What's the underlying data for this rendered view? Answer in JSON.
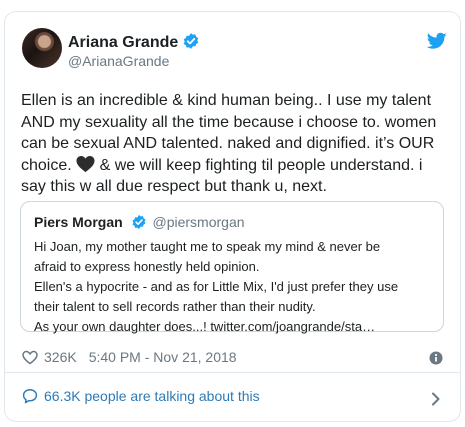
{
  "tweet": {
    "author": {
      "name": "Ariana Grande",
      "handle": "@ArianaGrande",
      "verified": true
    },
    "text_before_emoji": "Ellen is an incredible & kind human being.. I use my talent AND my sexuality all the time because i choose to. women can be sexual AND talented. naked and dignified. it’s OUR choice. ",
    "emoji": "black-heart",
    "text_after_emoji": " & we will keep fighting til people understand. i say this w all due respect but thank u, next.",
    "quoted": {
      "name": "Piers Morgan",
      "handle": "@piersmorgan",
      "verified": true,
      "lines": [
        "Hi Joan, my mother taught me to speak my mind & never be",
        "afraid to express honestly held opinion.",
        "Ellen's a hypocrite - and as for Little Mix, I'd just prefer they use",
        "their talent to sell records rather than their nudity.",
        "As your own daughter does...! twitter.com/joangrande/sta…"
      ]
    },
    "likes": "326K",
    "timestamp": "5:40 PM - Nov 21, 2018",
    "talking_about": "66.3K people are talking about this"
  },
  "colors": {
    "text": "#1c2022",
    "secondary": "#697882",
    "link": "#2b7bb9",
    "verified_badge": "#1da1f2",
    "twitter_bird": "#1da1f2",
    "border": "#e1e8ed"
  },
  "icons": [
    "verified-badge-icon",
    "twitter-bird-icon",
    "black-heart-emoji-icon",
    "like-heart-icon",
    "info-icon",
    "speech-bubble-icon",
    "chevron-right-icon"
  ]
}
